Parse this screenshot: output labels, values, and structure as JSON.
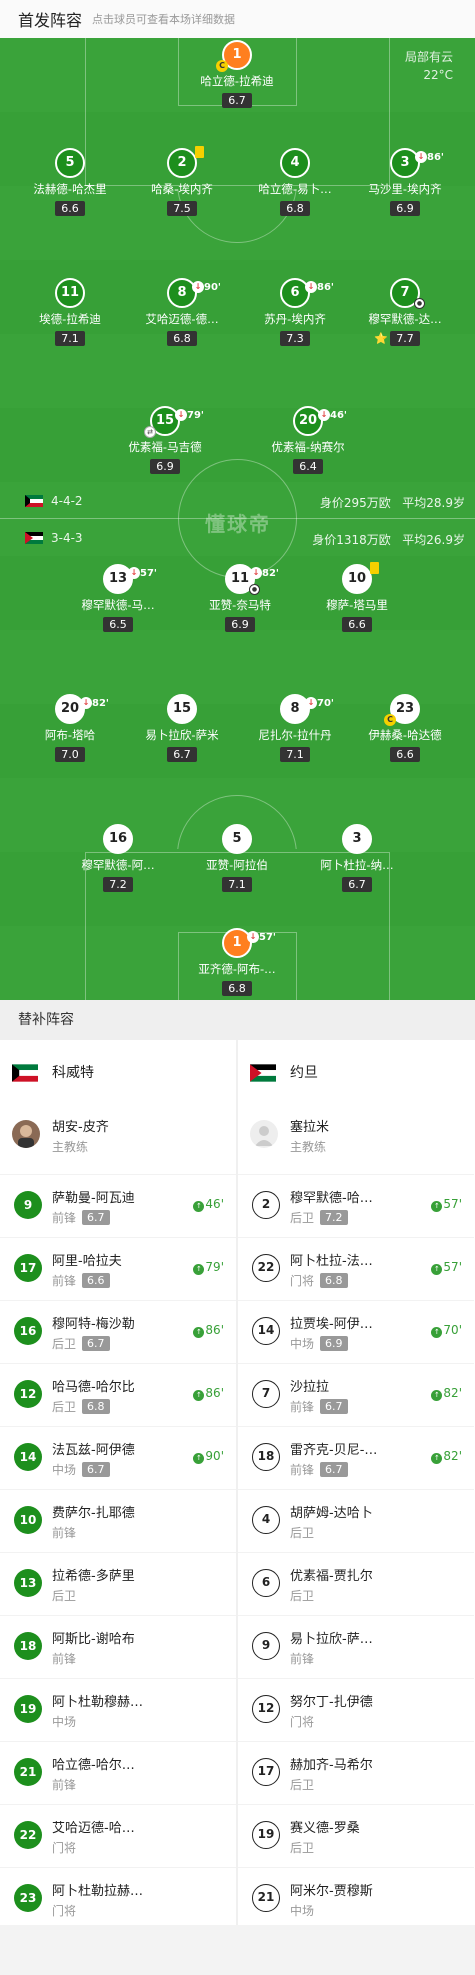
{
  "header": {
    "title": "首发阵容",
    "subtitle": "点击球员可查看本场详细数据"
  },
  "weather": {
    "condition": "局部有云",
    "temp": "22°C"
  },
  "watermark": "懂球帝",
  "teams": {
    "away": {
      "formation": "4-4-2",
      "value": "身价295万欧",
      "age": "平均28.9岁",
      "name": "科威特"
    },
    "home": {
      "formation": "3-4-3",
      "value": "身价1318万欧",
      "age": "平均26.9岁",
      "name": "约旦"
    }
  },
  "away_players": [
    {
      "num": "1",
      "name": "哈立德-拉希迪",
      "rating": "6.7",
      "gk": true,
      "captain": "C"
    },
    {
      "num": "5",
      "name": "法赫德-哈杰里",
      "rating": "6.6"
    },
    {
      "num": "2",
      "name": "哈桑-埃内齐",
      "rating": "7.5",
      "ycard": true
    },
    {
      "num": "4",
      "name": "哈立德-易卜…",
      "rating": "6.8"
    },
    {
      "num": "3",
      "name": "马沙里-埃内齐",
      "rating": "6.9",
      "sub_min": "86'"
    },
    {
      "num": "11",
      "name": "埃德-拉希迪",
      "rating": "7.1"
    },
    {
      "num": "8",
      "name": "艾哈迈德-德…",
      "rating": "6.8",
      "sub_min": "90'"
    },
    {
      "num": "6",
      "name": "苏丹-埃内齐",
      "rating": "7.3",
      "sub_min": "86'"
    },
    {
      "num": "7",
      "name": "穆罕默德-达…",
      "rating": "7.7",
      "goal": true,
      "mvp": true
    },
    {
      "num": "15",
      "name": "优素福-马吉德",
      "rating": "6.9",
      "sub_min": "79'",
      "subbed_in": true
    },
    {
      "num": "20",
      "name": "优素福-纳赛尔",
      "rating": "6.4",
      "sub_min": "46'"
    }
  ],
  "home_players": [
    {
      "num": "13",
      "name": "穆罕默德-马…",
      "rating": "6.5",
      "sub_min": "57'"
    },
    {
      "num": "11",
      "name": "亚赞-奈马特",
      "rating": "6.9",
      "sub_min": "82'",
      "goal": true
    },
    {
      "num": "10",
      "name": "穆萨-塔马里",
      "rating": "6.6",
      "ycard": true
    },
    {
      "num": "20",
      "name": "阿布-塔哈",
      "rating": "7.0",
      "sub_min": "82'"
    },
    {
      "num": "15",
      "name": "易卜拉欣-萨米",
      "rating": "6.7"
    },
    {
      "num": "8",
      "name": "尼扎尔-拉什丹",
      "rating": "7.1",
      "sub_min": "70'"
    },
    {
      "num": "23",
      "name": "伊赫桑-哈达德",
      "rating": "6.6",
      "captain": "C"
    },
    {
      "num": "16",
      "name": "穆罕默德-阿…",
      "rating": "7.2"
    },
    {
      "num": "5",
      "name": "亚赞-阿拉伯",
      "rating": "7.1"
    },
    {
      "num": "3",
      "name": "阿卜杜拉-纳…",
      "rating": "6.7"
    },
    {
      "num": "1",
      "name": "亚齐德-阿布-…",
      "rating": "6.8",
      "gk": true,
      "sub_min": "57'"
    }
  ],
  "bench": {
    "title": "替补阵容",
    "away_coach": {
      "name": "胡安-皮齐",
      "role": "主教练"
    },
    "home_coach": {
      "name": "塞拉米",
      "role": "主教练"
    },
    "away": [
      {
        "num": "9",
        "name": "萨勒曼-阿瓦迪",
        "pos": "前锋",
        "rating": "6.7",
        "min": "46'"
      },
      {
        "num": "17",
        "name": "阿里-哈拉夫",
        "pos": "前锋",
        "rating": "6.6",
        "min": "79'"
      },
      {
        "num": "16",
        "name": "穆阿特-梅沙勒",
        "pos": "后卫",
        "rating": "6.7",
        "min": "86'"
      },
      {
        "num": "12",
        "name": "哈马德-哈尔比",
        "pos": "后卫",
        "rating": "6.8",
        "min": "86'"
      },
      {
        "num": "14",
        "name": "法瓦兹-阿伊德",
        "pos": "中场",
        "rating": "6.7",
        "min": "90'"
      },
      {
        "num": "10",
        "name": "费萨尔-扎耶德",
        "pos": "前锋"
      },
      {
        "num": "13",
        "name": "拉希德-多萨里",
        "pos": "后卫"
      },
      {
        "num": "18",
        "name": "阿斯比-谢哈布",
        "pos": "前锋"
      },
      {
        "num": "19",
        "name": "阿卜杜勒穆赫…",
        "pos": "中场"
      },
      {
        "num": "21",
        "name": "哈立德-哈尔…",
        "pos": "前锋"
      },
      {
        "num": "22",
        "name": "艾哈迈德-哈…",
        "pos": "门将"
      },
      {
        "num": "23",
        "name": "阿卜杜勒拉赫…",
        "pos": "门将"
      }
    ],
    "home": [
      {
        "num": "2",
        "name": "穆罕默德-哈…",
        "pos": "后卫",
        "rating": "7.2",
        "min": "57'"
      },
      {
        "num": "22",
        "name": "阿卜杜拉-法…",
        "pos": "门将",
        "rating": "6.8",
        "min": "57'"
      },
      {
        "num": "14",
        "name": "拉贾埃-阿伊…",
        "pos": "中场",
        "rating": "6.9",
        "min": "70'"
      },
      {
        "num": "7",
        "name": "沙拉拉",
        "pos": "前锋",
        "rating": "6.7",
        "min": "82'"
      },
      {
        "num": "18",
        "name": "雷齐克-贝尼-…",
        "pos": "前锋",
        "rating": "6.7",
        "min": "82'"
      },
      {
        "num": "4",
        "name": "胡萨姆-达哈卜",
        "pos": "后卫"
      },
      {
        "num": "6",
        "name": "优素福-贾扎尔",
        "pos": "后卫"
      },
      {
        "num": "9",
        "name": "易卜拉欣-萨…",
        "pos": "前锋"
      },
      {
        "num": "12",
        "name": "努尔丁-扎伊德",
        "pos": "门将"
      },
      {
        "num": "17",
        "name": "赫加齐-马希尔",
        "pos": "后卫"
      },
      {
        "num": "19",
        "name": "赛义德-罗桑",
        "pos": "后卫"
      },
      {
        "num": "21",
        "name": "阿米尔-贾穆斯",
        "pos": "中场"
      }
    ]
  }
}
